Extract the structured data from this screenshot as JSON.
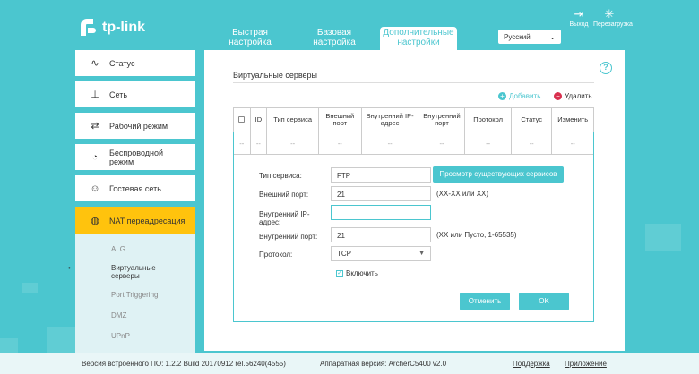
{
  "header": {
    "logo_text": "tp-link",
    "tabs": [
      {
        "label": "Быстрая настройка"
      },
      {
        "label": "Базовая настройка"
      },
      {
        "label": "Дополнительные настройки"
      }
    ],
    "language": "Русский",
    "logout_label": "Выход",
    "reboot_label": "Перезагрузка"
  },
  "sidebar": {
    "items": [
      {
        "label": "Статус",
        "icon": "pulse-icon"
      },
      {
        "label": "Сеть",
        "icon": "network-icon"
      },
      {
        "label": "Рабочий режим",
        "icon": "mode-icon"
      },
      {
        "label": "Беспроводной режим",
        "icon": "wifi-icon"
      },
      {
        "label": "Гостевая сеть",
        "icon": "guest-icon"
      },
      {
        "label": "NAT переадресация",
        "icon": "nat-icon"
      }
    ],
    "sub_items": [
      {
        "label": "ALG"
      },
      {
        "label": "Виртуальные серверы"
      },
      {
        "label": "Port Triggering"
      },
      {
        "label": "DMZ"
      },
      {
        "label": "UPnP"
      }
    ]
  },
  "main": {
    "title": "Виртуальные серверы",
    "add_label": "Добавить",
    "delete_label": "Удалить",
    "help_glyph": "?",
    "table": {
      "headers": [
        "ID",
        "Тип сервиса",
        "Внешний порт",
        "Внутренний IP-адрес",
        "Внутренний порт",
        "Протокол",
        "Статус",
        "Изменить"
      ],
      "row": [
        "--",
        "--",
        "--",
        "--",
        "--",
        "--",
        "--",
        "--",
        "--"
      ]
    },
    "form": {
      "service_type_label": "Тип сервиса:",
      "service_type_value": "FTP",
      "view_services_button": "Просмотр существующих сервисов",
      "external_port_label": "Внешний порт:",
      "external_port_value": "21",
      "external_port_hint": "(XX-XX или XX)",
      "internal_ip_label": "Внутренний IP-адрес:",
      "internal_ip_value": "",
      "internal_port_label": "Внутренний порт:",
      "internal_port_value": "21",
      "internal_port_hint": "(XX или Пусто, 1-65535)",
      "protocol_label": "Протокол:",
      "protocol_value": "TCP",
      "enable_label": "Включить",
      "enabled": true,
      "cancel_button": "Отменить",
      "ok_button": "OK"
    }
  },
  "footer": {
    "firmware": "Версия встроенного ПО: 1.2.2 Build 20170912 rel.56240(4555)",
    "hardware": "Аппаратная версия: ArcherC5400 v2.0",
    "support_link": "Поддержка",
    "app_link": "Приложение"
  },
  "colors": {
    "accent": "#4bc6cf",
    "active_nav": "#ffc30d",
    "delete": "#d9304f"
  }
}
